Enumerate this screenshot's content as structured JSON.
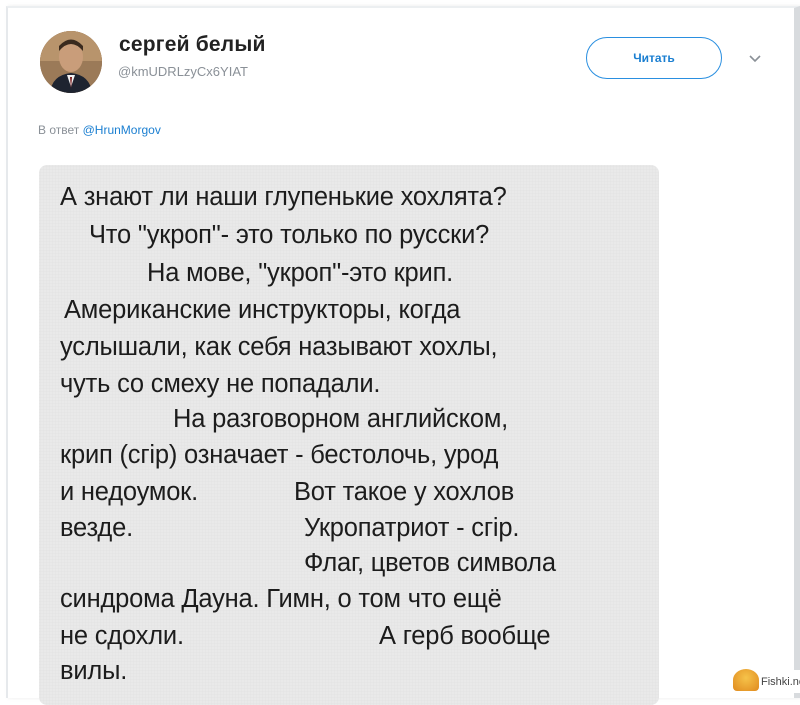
{
  "tweet": {
    "author_name": "сергей белый",
    "author_handle": "@kmUDRLzyCx6YIAT",
    "follow_label": "Читать",
    "reply_prefix": "В ответ",
    "reply_mention": "@HrunMorgov"
  },
  "image_text": {
    "lines": [
      "А знают ли наши глупенькие хохлята?",
      "Что \"укроп\"- это только по русски?",
      "На мове, \"укроп\"-это крип.",
      "Американские инструкторы, когда",
      "услышали, как себя называют хохлы,",
      "чуть со смеху не попадали.",
      "На разговорном английском,",
      "крип (сгір) означает - бестолочь, урод",
      "и недоумок.",
      "Вот такое у хохлов",
      "везде.",
      "Укропатриот - сгір.",
      "Флаг, цветов символа",
      "синдрома Дауна. Гимн, о том что ещё",
      "не сдохли.",
      "А герб вообще",
      "вилы."
    ]
  },
  "watermark": {
    "text": "Fishki.net"
  },
  "colors": {
    "accent": "#1b7fd1",
    "card_bg": "#e9e9e9"
  }
}
